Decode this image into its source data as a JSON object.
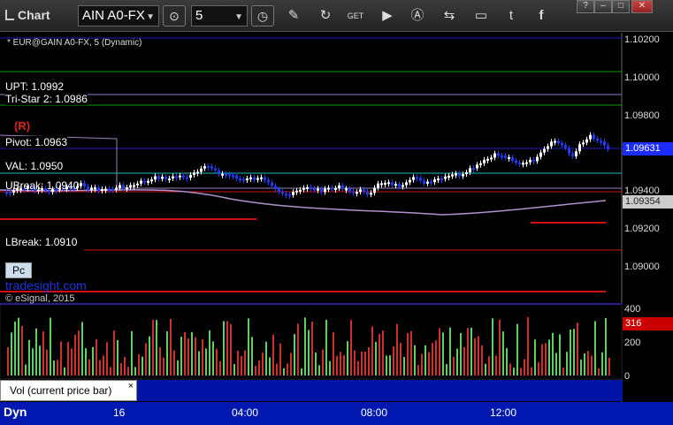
{
  "toolbar": {
    "title": "Chart",
    "symbol": "AIN A0-FX",
    "interval": "5",
    "icons": [
      "target-icon",
      "clock-icon",
      "pen-icon",
      "refresh-icon",
      "get-icon",
      "play-icon",
      "a-icon",
      "link-icon",
      "chat-icon",
      "twitter-icon",
      "facebook-icon"
    ]
  },
  "window_buttons": [
    "?",
    "–",
    "□",
    "✕"
  ],
  "series_label": "* EUR@GAIN A0-FX, 5 (Dynamic)",
  "price_labels": {
    "upt": "UPT: 1.0992",
    "tristar": "Tri-Star 2: 1.0986",
    "r_badge": "(R)",
    "pivot": "Pivot: 1.0963",
    "val": "VAL: 1.0950",
    "ubreak": "UBreak: 1.0940",
    "lbreak": "LBreak: 1.0910"
  },
  "price_axis": [
    "1.10200",
    "1.10000",
    "1.09800",
    "1.09400",
    "1.09200",
    "1.09000"
  ],
  "price_tags": {
    "last": "1.09631",
    "ma": "1.09354"
  },
  "volume_axis": [
    "400",
    "200",
    "0"
  ],
  "volume_tag": "316",
  "watermark": "tradesight.com",
  "copyright": "© eSignal, 2015",
  "pc_button": "Pc",
  "vol_panel_label": "Vol (current price bar)",
  "vol_close": "×",
  "time_axis": {
    "dyn": "Dyn",
    "labels": [
      "16",
      "04:00",
      "08:00",
      "12:00"
    ]
  },
  "colors": {
    "up": "#ffffff",
    "down": "#1c3cff",
    "grid_red": "#d01010",
    "green_line": "#00a000",
    "pivot_blue": "#2020c0",
    "ma": "#b090d0"
  }
}
